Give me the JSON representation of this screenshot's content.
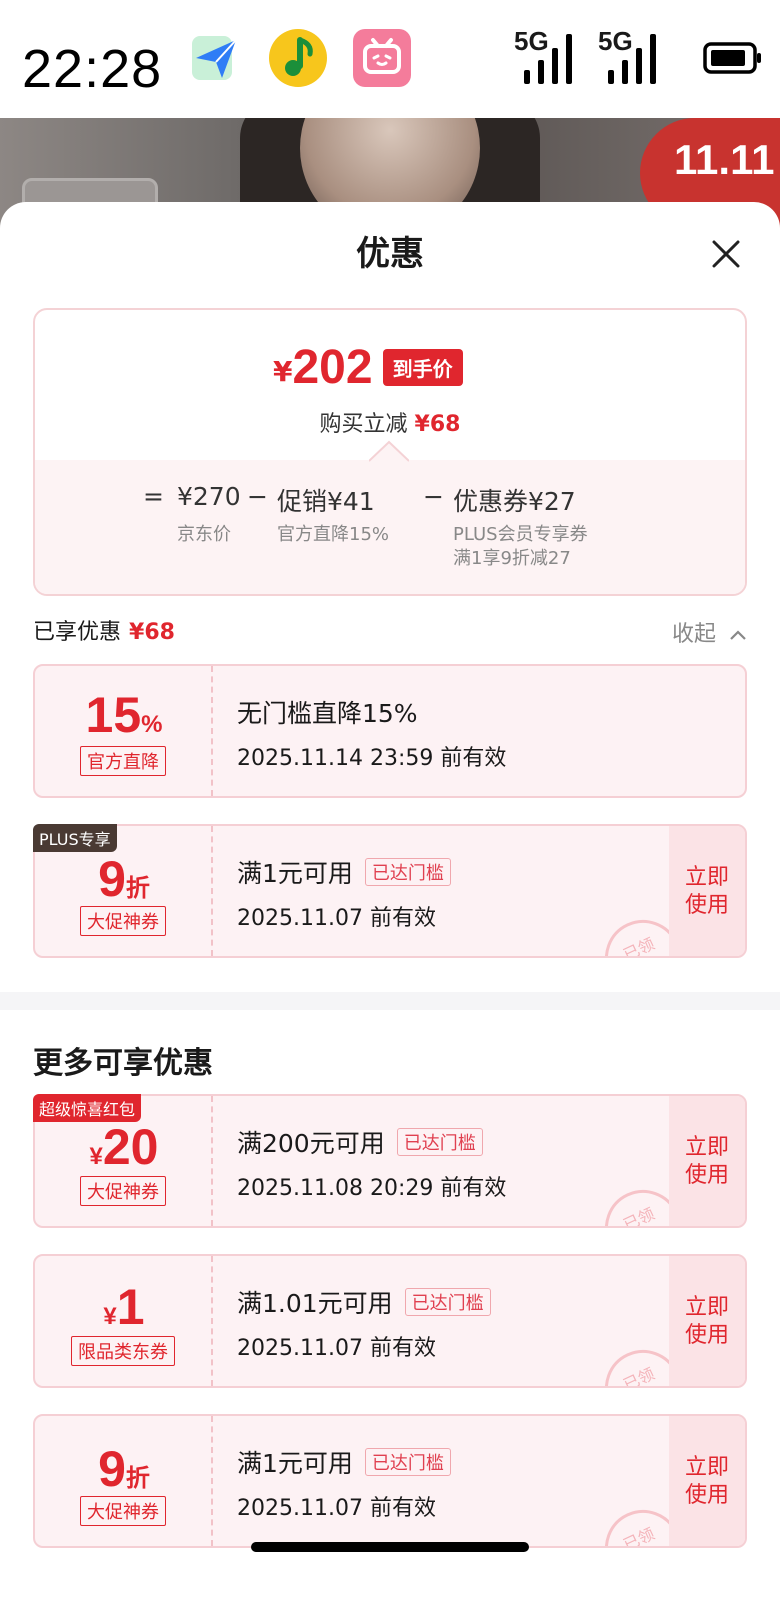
{
  "status_bar": {
    "time": "22:28",
    "signal_1": "5G",
    "signal_2": "5G",
    "apps": [
      "feishu-icon",
      "qq-music-icon",
      "bilibili-icon"
    ]
  },
  "banner": {
    "badge": "11.11"
  },
  "sheet": {
    "title": "优惠"
  },
  "summary": {
    "price_symbol": "¥",
    "price": "202",
    "price_tag": "到手价",
    "save_prefix": "购买立减",
    "save_amount": "¥68",
    "calc": {
      "equals": "=",
      "base": "¥270",
      "base_label": "京东价",
      "minus_1": "−",
      "promo": "促销¥41",
      "promo_label": "官方直降15%",
      "minus_2": "−",
      "coupon": "优惠券¥27",
      "coupon_label_1": "PLUS会员专享券",
      "coupon_label_2": "满1享9折减27"
    }
  },
  "enjoyed": {
    "label": "已享优惠",
    "amount": "¥68",
    "collapse": "收起"
  },
  "enjoyed_coupons": [
    {
      "value": "15",
      "unit": "%",
      "kind": "官方直降",
      "title": "无门槛直降15%",
      "reached": "",
      "expire": "2025.11.14 23:59 前有效"
    },
    {
      "corner": "PLUS专享",
      "value": "9",
      "unit": "折",
      "kind": "大促神券",
      "title": "满1元可用",
      "reached": "已达门槛",
      "expire": "2025.11.07 前有效",
      "use": "立即使用",
      "stamp": "已领"
    }
  ],
  "more": {
    "title": "更多可享优惠",
    "coupons": [
      {
        "corner": "超级惊喜红包",
        "prefix": "¥",
        "value": "20",
        "kind": "大促神券",
        "title": "满200元可用",
        "reached": "已达门槛",
        "expire": "2025.11.08 20:29 前有效",
        "use": "立即使用",
        "stamp": "已领"
      },
      {
        "prefix": "¥",
        "value": "1",
        "kind": "限品类东券",
        "title": "满1.01元可用",
        "reached": "已达门槛",
        "expire": "2025.11.07 前有效",
        "use": "立即使用",
        "stamp": "已领"
      },
      {
        "value": "9",
        "unit": "折",
        "kind": "大促神券",
        "title": "满1元可用",
        "reached": "已达门槛",
        "expire": "2025.11.07 前有效",
        "use": "立即使用",
        "stamp": "已领"
      }
    ]
  },
  "colors": {
    "accent_red": "#e0262e",
    "coupon_bg": "#fdf2f4",
    "plus_brown": "#4a3a33"
  }
}
